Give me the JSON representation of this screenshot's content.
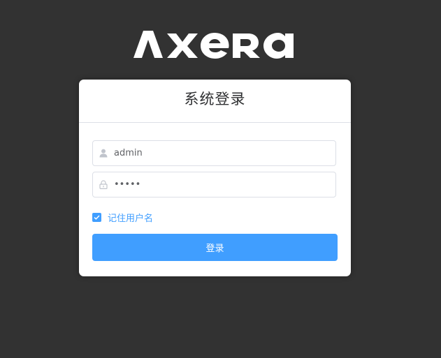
{
  "brand": {
    "logo_text": "AXERA",
    "logo_icon": "axera-logo"
  },
  "login": {
    "title": "系统登录",
    "username": {
      "value": "admin",
      "icon": "user-icon"
    },
    "password": {
      "value": "•••••",
      "icon": "lock-icon"
    },
    "remember": {
      "label": "记住用户名",
      "checked": true
    },
    "submit_label": "登录"
  },
  "colors": {
    "background": "#323232",
    "card": "#ffffff",
    "primary": "#409eff",
    "border": "#dcdfe6",
    "title_text": "#303133",
    "input_text": "#606266"
  }
}
